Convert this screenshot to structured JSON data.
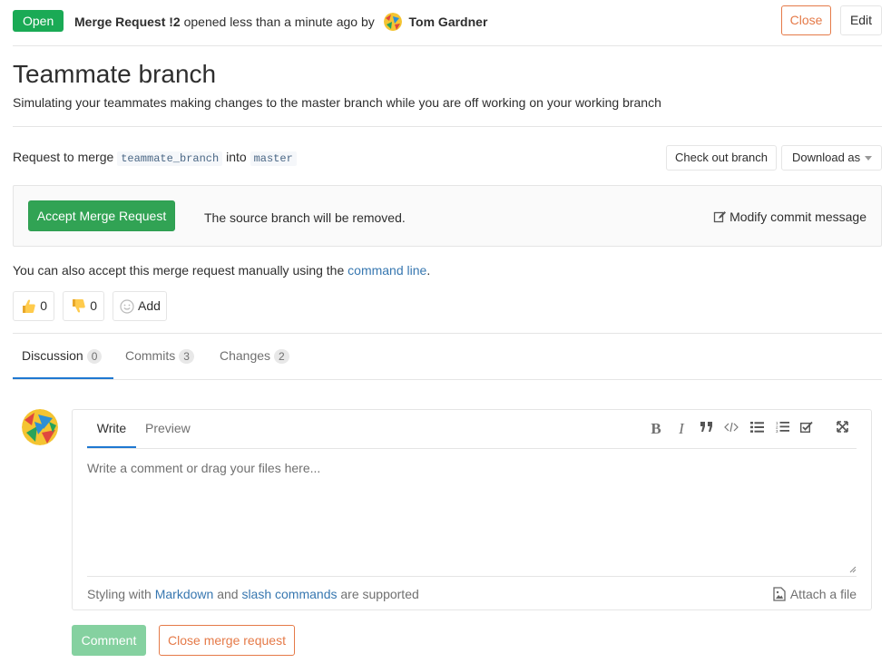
{
  "header": {
    "status": "Open",
    "mr_ref": "Merge Request !2",
    "opened_text": "opened less than a minute ago by",
    "author": "Tom Gardner",
    "close_label": "Close",
    "edit_label": "Edit"
  },
  "title": "Teammate branch",
  "description": "Simulating your teammates making changes to the master branch while you are off working on your working branch",
  "merge": {
    "request_prefix": "Request to merge",
    "source_branch": "teammate_branch",
    "into": "into",
    "target_branch": "master",
    "checkout_label": "Check out branch",
    "download_label": "Download as",
    "accept_label": "Accept Merge Request",
    "removal_note": "The source branch will be removed.",
    "modify_label": "Modify commit message",
    "manual_prefix": "You can also accept this merge request manually using the",
    "manual_link": "command line",
    "manual_suffix": "."
  },
  "awards": {
    "thumbsup_count": "0",
    "thumbsdown_count": "0",
    "add_label": "Add"
  },
  "tabs": [
    {
      "label": "Discussion",
      "count": "0"
    },
    {
      "label": "Commits",
      "count": "3"
    },
    {
      "label": "Changes",
      "count": "2"
    }
  ],
  "comment": {
    "write_tab": "Write",
    "preview_tab": "Preview",
    "placeholder": "Write a comment or drag your files here...",
    "hint_prefix": "Styling with",
    "hint_markdown": "Markdown",
    "hint_and": "and",
    "hint_slash": "slash commands",
    "hint_suffix": "are supported",
    "attach_label": "Attach a file",
    "submit_label": "Comment",
    "close_mr_label": "Close merge request"
  },
  "colors": {
    "open_green": "#1aaa55",
    "accept_green": "#31a354",
    "warning_orange": "#e57a48",
    "link_blue": "#3777b0",
    "active_tab_blue": "#1f78d1"
  },
  "icons": [
    "user-avatar",
    "thumbsup-icon",
    "thumbsdown-icon",
    "smiley-icon",
    "edit-icon",
    "bold-icon",
    "italic-icon",
    "quote-icon",
    "code-icon",
    "bullet-list-icon",
    "numbered-list-icon",
    "task-list-icon",
    "fullscreen-icon",
    "image-icon"
  ]
}
